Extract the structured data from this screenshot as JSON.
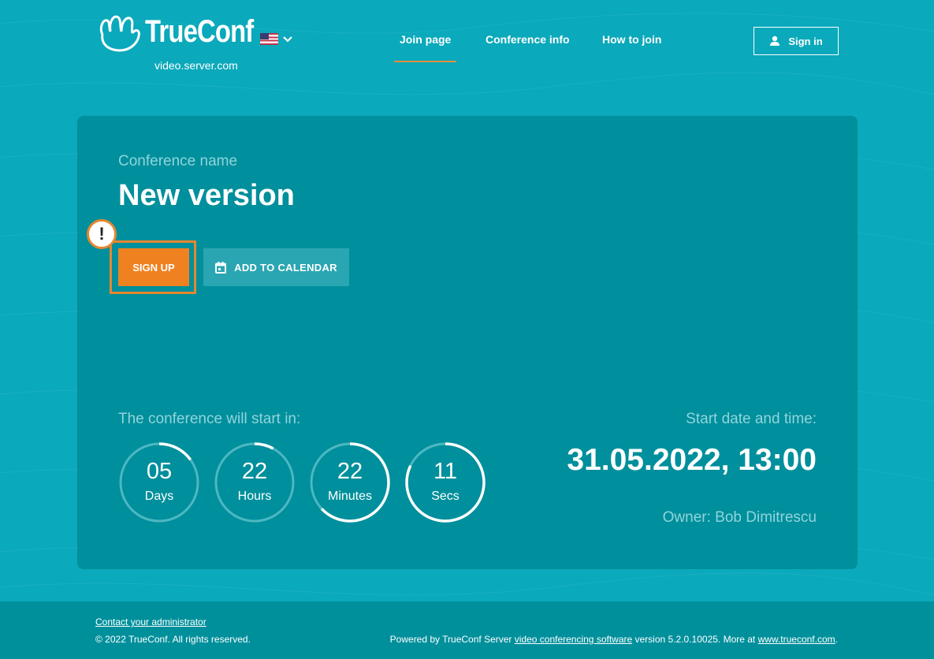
{
  "header": {
    "brand": "TrueConf",
    "domain": "video.server.com",
    "nav": [
      {
        "label": "Join page",
        "active": true
      },
      {
        "label": "Conference info",
        "active": false
      },
      {
        "label": "How to join",
        "active": false
      }
    ],
    "signin_label": "Sign in"
  },
  "conference": {
    "name_label": "Conference name",
    "name": "New version",
    "signup_label": "SIGN UP",
    "warning_mark": "!",
    "add_calendar_label": "ADD TO CALENDAR",
    "countdown_label": "The conference will start in:",
    "countdown": [
      {
        "value": "05",
        "unit": "Days",
        "progress": 0.15
      },
      {
        "value": "22",
        "unit": "Hours",
        "progress": 0.08
      },
      {
        "value": "22",
        "unit": "Minutes",
        "progress": 0.63
      },
      {
        "value": "11",
        "unit": "Secs",
        "progress": 0.82
      }
    ],
    "date_label": "Start date and time:",
    "date_value": "31.05.2022, 13:00",
    "owner": "Owner: Bob Dimitrescu"
  },
  "footer": {
    "contact": "Contact your administrator",
    "copyright": "© 2022 TrueConf. All rights reserved.",
    "powered_prefix": "Powered by TrueConf Server ",
    "powered_link": "video conferencing software",
    "powered_mid": " version 5.2.0.10025. More at ",
    "site_link": "www.trueconf.com",
    "powered_suffix": "."
  },
  "colors": {
    "background": "#0aa9bb",
    "card": "#008f9c",
    "accent": "#f08120",
    "secondary_button": "#2aa6b2"
  },
  "icons": [
    "trueconf-logo-icon",
    "us-flag-icon",
    "chevron-down-icon",
    "user-icon",
    "calendar-icon",
    "warning-icon"
  ]
}
